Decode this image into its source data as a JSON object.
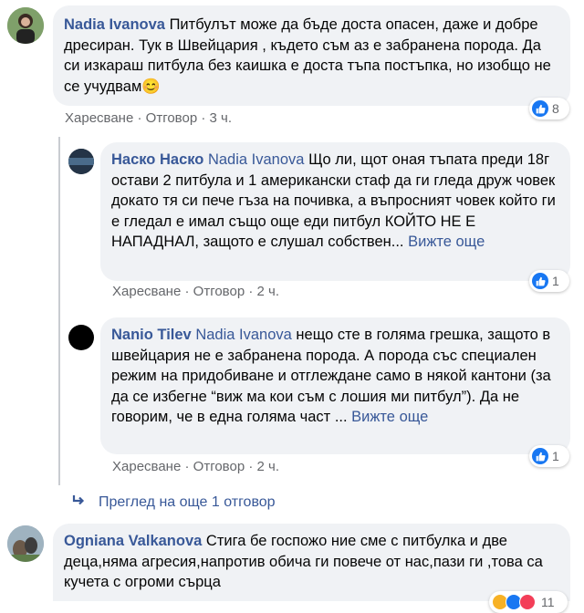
{
  "comments": [
    {
      "author": "Nadia Ivanova",
      "text": "Питбулът може да бъде доста опасен, даже и добре дресиран. Тук в Швейцария , където съм аз е забранена порода. Да си изкараш питбула без каишка е доста тъпа постъпка, но изобщо не се учудвам😊",
      "actions": {
        "like": "Харесване",
        "reply": "Отговор",
        "time": "3 ч."
      },
      "reactions": "8"
    },
    {
      "author": "Наско Наско",
      "mention": "Nadia Ivanova",
      "text": "Що ли, щот оная тъпата преди 18г остави 2 питбула и 1 американски стаф да ги гледа друж човек докато тя си пече гъза на почивка, а въпросният човек който ги е гледал е имал също още еди питбул КОЙТО НЕ Е НАПАДНАЛ, защото е слушал собствен...",
      "see_more": "Вижте още",
      "actions": {
        "like": "Харесване",
        "reply": "Отговор",
        "time": "2 ч."
      },
      "reactions": "1"
    },
    {
      "author": "Nanio Tilev",
      "mention": "Nadia Ivanova",
      "text": "нещо сте в голяма грешка, защото в швейцария не е забранена порода. А порода със специален режим на придобиване и отглеждане само в някой кантони (за да се избегне “виж ма кои съм с лошия ми питбул”). Да не говорим, че в една голяма част ...",
      "see_more": "Вижте още",
      "actions": {
        "like": "Харесване",
        "reply": "Отговор",
        "time": "2 ч."
      },
      "reactions": "1"
    },
    {
      "author": "Ogniana Valkanova",
      "text": "Стига бе госпожо ние сме с питбулка и две деца,няма агресия,напротив обича ги повече от нас,пази ги ,това са кучета с огроми сърца",
      "reactions": "11"
    }
  ],
  "more_replies": "Преглед на още 1 отговор",
  "colors": {
    "link": "#385898",
    "bubble": "#f0f2f5",
    "like": "#1877f2",
    "meta": "#65676b"
  }
}
